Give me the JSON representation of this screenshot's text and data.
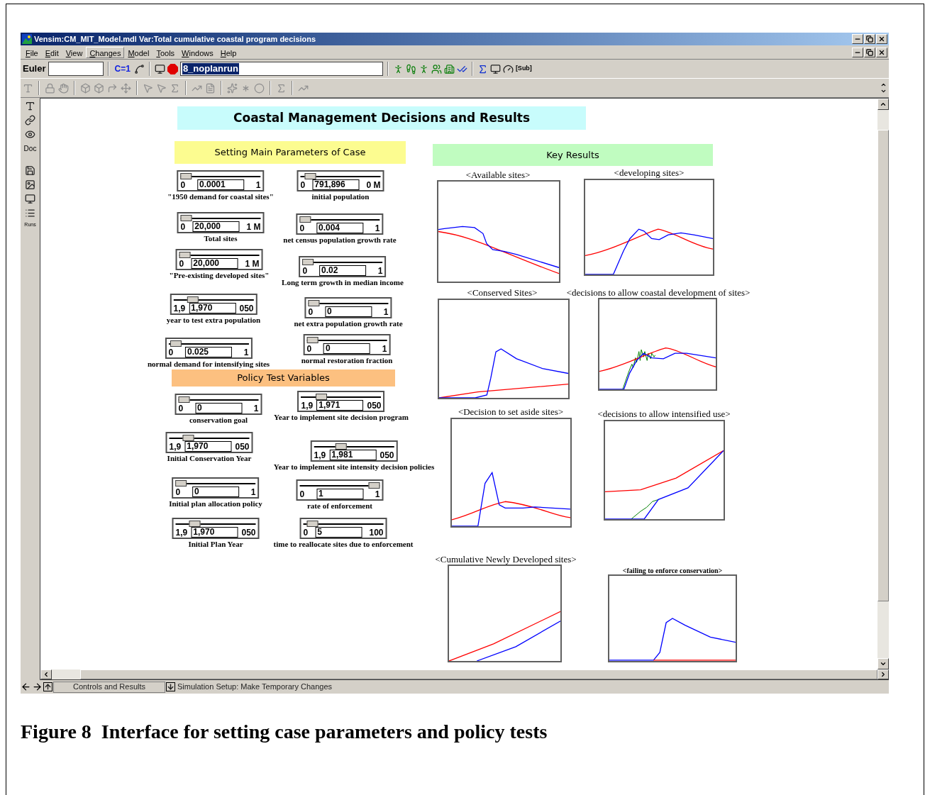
{
  "window": {
    "title": "Vensim:CM_MIT_Model.mdl Var:Total cumulative coastal program decisions"
  },
  "menu": [
    {
      "label": "File",
      "selected": false
    },
    {
      "label": "Edit",
      "selected": false
    },
    {
      "label": "View",
      "selected": false
    },
    {
      "label": "Changes",
      "selected": true
    },
    {
      "label": "Model",
      "selected": false
    },
    {
      "label": "Tools",
      "selected": false
    },
    {
      "label": "Windows",
      "selected": false
    },
    {
      "label": "Help",
      "selected": false
    }
  ],
  "toolbar": {
    "method": "Euler",
    "constant_button": "C=1",
    "run_name": "8_noplanrun",
    "sub_button": "[Sub]"
  },
  "left_toolbar": {
    "doc": "Doc",
    "runs": "Runs"
  },
  "banners": [
    {
      "text": "Coastal Management Decisions and Results",
      "color": "#c8fcfc"
    },
    {
      "text": "Setting Main Parameters of Case",
      "color": "#fcfc90"
    },
    {
      "text": "Key Results",
      "color": "#c0fcc0"
    },
    {
      "text": "Policy Test Variables",
      "color": "#fcc080"
    }
  ],
  "sliders": [
    {
      "label": "\"1950 demand for coastal sites\"",
      "min": "0",
      "value": "0.0001",
      "max": "1",
      "level": 0
    },
    {
      "label": "initial population",
      "min": "0",
      "value": "791,896",
      "max": "0 M",
      "level": 0.06
    },
    {
      "label": "Total sites",
      "min": "0",
      "value": "20,000",
      "max": "1 M",
      "level": 0
    },
    {
      "label": "net census population growth rate",
      "min": "0",
      "value": "0.004",
      "max": "1",
      "level": 0
    },
    {
      "label": "\"Pre-existing developed sites\"",
      "min": "0",
      "value": "20,000",
      "max": "1 M",
      "level": 0
    },
    {
      "label": "Long term growth in median income",
      "min": "0",
      "value": "0.02",
      "max": "1",
      "level": 0
    },
    {
      "label": "year to test extra population",
      "min": "1,9",
      "value": "1,970",
      "max": "050",
      "level": 0.2
    },
    {
      "label": "net extra population growth rate",
      "min": "0",
      "value": "0",
      "max": "1",
      "level": 0
    },
    {
      "label": "normal demand for intensifying sites",
      "min": "0",
      "value": "0.025",
      "max": "1",
      "level": 0.03
    },
    {
      "label": "normal restoration fraction",
      "min": "0",
      "value": "0",
      "max": "1",
      "level": 0
    },
    {
      "label": "conservation goal",
      "min": "0",
      "value": "0",
      "max": "1",
      "level": 0
    },
    {
      "label": "Year to implement site decision program",
      "min": "1,9",
      "value": "1,971",
      "max": "050",
      "level": 0.21
    },
    {
      "label": "Initial Conservation Year",
      "min": "1,9",
      "value": "1,970",
      "max": "050",
      "level": 0.2
    },
    {
      "label": "Year to implement site intensity decision policies",
      "min": "1,9",
      "value": "1,981",
      "max": "050",
      "level": 0.31
    },
    {
      "label": "Initial plan allocation policy",
      "min": "0",
      "value": "0",
      "max": "1",
      "level": 0
    },
    {
      "label": "rate of enforcement",
      "min": "0",
      "value": "1",
      "max": "1",
      "level": 1
    },
    {
      "label": "Initial Plan Year",
      "min": "1,9",
      "value": "1,970",
      "max": "050",
      "level": 0.2
    },
    {
      "label": "time to reallocate sites due to enforcement",
      "min": "0",
      "value": "5",
      "max": "100",
      "level": 0.05
    }
  ],
  "charts": [
    {
      "title": "<Available sites>"
    },
    {
      "title": "<developing sites>"
    },
    {
      "title": "<Conserved Sites>"
    },
    {
      "title": "<decisions to allow coastal development of sites>"
    },
    {
      "title": "<Decision to set aside sites>"
    },
    {
      "title": "<decisions to allow intensified use>"
    },
    {
      "title": "<Cumulative Newly Developed sites>"
    },
    {
      "title": "<failing to enforce conservation>"
    }
  ],
  "status_bar": {
    "view": "Controls and Results",
    "message": "Simulation Setup: Make Temporary Changes"
  },
  "caption": "Figure 8  Interface for setting case parameters and policy tests"
}
